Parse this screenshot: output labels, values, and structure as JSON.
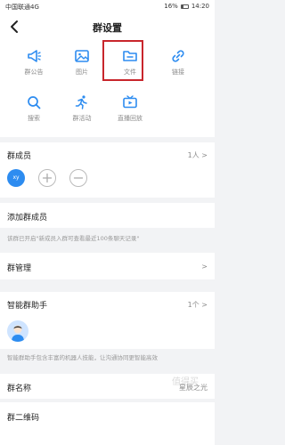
{
  "status_bar": {
    "carrier": "中国联通4G",
    "battery": "16%",
    "time": "14:20"
  },
  "nav": {
    "title": "群设置"
  },
  "features": [
    {
      "label": "群公告",
      "icon": "megaphone-icon"
    },
    {
      "label": "图片",
      "icon": "image-icon"
    },
    {
      "label": "文件",
      "icon": "folder-icon"
    },
    {
      "label": "链接",
      "icon": "link-icon"
    },
    {
      "label": "搜索",
      "icon": "search-icon"
    },
    {
      "label": "群活动",
      "icon": "running-icon"
    },
    {
      "label": "直播回放",
      "icon": "tv-icon"
    }
  ],
  "members": {
    "title": "群成员",
    "count": "1人",
    "avatar": "xy"
  },
  "add_member": {
    "label": "添加群成员"
  },
  "notice": "该群已开启\"新成员入群可查看最近100条聊天记录\"",
  "group_manage": {
    "label": "群管理"
  },
  "assistant": {
    "title": "智能群助手",
    "count": "1个",
    "desc": "智能群助手包含丰富的机器人技能，让沟通协同更智能高效"
  },
  "group_name": {
    "label": "群名称",
    "value": "星辰之光"
  },
  "qr": {
    "label": "群二维码"
  },
  "watermark": "值得买",
  "colors": {
    "accent": "#2d8cf0",
    "highlight": "#c8262c",
    "background": "#f2f3f5"
  }
}
